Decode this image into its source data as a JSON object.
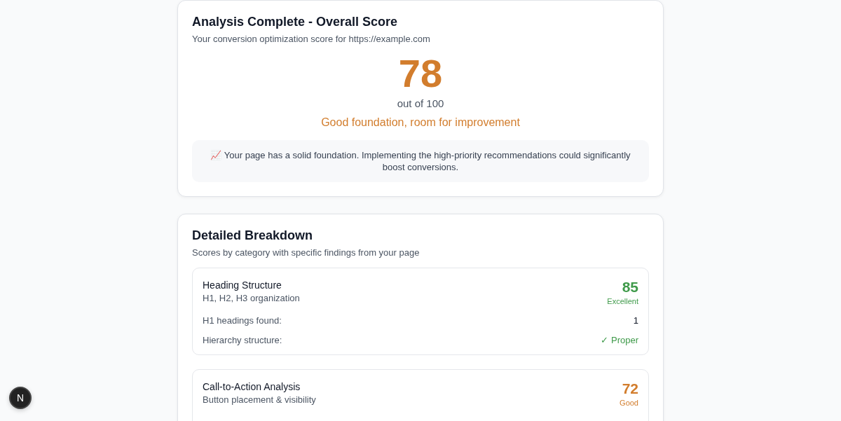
{
  "overall": {
    "title": "Analysis Complete - Overall Score",
    "subtitle": "Your conversion optimization score for https://example.com",
    "score": "78",
    "out_of": "out of 100",
    "verdict": "Good foundation, room for improvement",
    "note": "📈 Your page has a solid foundation. Implementing the high-priority recommendations could significantly boost conversions."
  },
  "breakdown": {
    "title": "Detailed Breakdown",
    "subtitle": "Scores by category with specific findings from your page",
    "categories": [
      {
        "name": "Heading Structure",
        "description": "H1, H2, H3 organization",
        "score": "85",
        "rating": "Excellent",
        "color": "#3f9a4a",
        "findings": [
          {
            "label": "H1 headings found:",
            "value": "1",
            "kind": "plain"
          },
          {
            "label": "Hierarchy structure:",
            "value": "✓ Proper",
            "kind": "positive"
          }
        ]
      },
      {
        "name": "Call-to-Action Analysis",
        "description": "Button placement & visibility",
        "score": "72",
        "rating": "Good",
        "color": "#d27d2d"
      }
    ]
  },
  "dev_badge": "N"
}
